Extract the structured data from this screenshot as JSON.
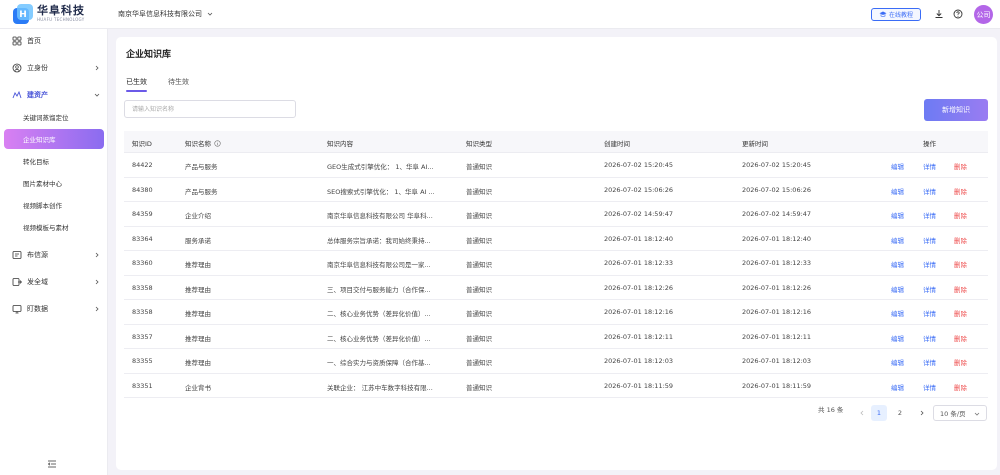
{
  "header": {
    "logo_name": "华阜科技",
    "logo_sub": "HUAFU TECHNOLOGY",
    "company": "南京华阜信息科技有限公司",
    "online_label": "在线教程",
    "avatar_text": "公司"
  },
  "sidebar": {
    "items": [
      {
        "label": "首页",
        "icon": "grid-icon"
      },
      {
        "label": "立身份",
        "icon": "id-icon"
      },
      {
        "label": "建资产",
        "icon": "asset-icon"
      },
      {
        "label": "布信源",
        "icon": "source-icon"
      },
      {
        "label": "发全域",
        "icon": "publish-icon"
      },
      {
        "label": "盯数据",
        "icon": "data-icon"
      }
    ],
    "sub_items": [
      "关键词蒸馏定位",
      "企业知识库",
      "转化目标",
      "图片素材中心",
      "视频脚本创作",
      "视频模板与素材"
    ],
    "selected_sub": "企业知识库"
  },
  "main": {
    "title": "企业知识库",
    "tabs": [
      "已生效",
      "待生效"
    ],
    "active_tab": "已生效",
    "search_placeholder": "请输入知识名称",
    "new_button": "新增知识",
    "columns": [
      "知识ID",
      "知识名称",
      "知识内容",
      "知识类型",
      "创建时间",
      "更新时间",
      "操作"
    ],
    "actions": {
      "edit": "编辑",
      "detail": "详情",
      "delete": "删除"
    },
    "rows": [
      {
        "id": "84422",
        "name": "产品与服务",
        "content": "GEO生成式引擎优化： 1、华阜 AI...",
        "type": "普通知识",
        "created": "2026-07-02 15:20:45",
        "updated": "2026-07-02 15:20:45"
      },
      {
        "id": "84380",
        "name": "产品与服务",
        "content": "SEO搜索式引擎优化： 1、华阜 AI ...",
        "type": "普通知识",
        "created": "2026-07-02 15:06:26",
        "updated": "2026-07-02 15:06:26"
      },
      {
        "id": "84359",
        "name": "企业介绍",
        "content": "南京华阜信息科技有限公司 华阜科...",
        "type": "普通知识",
        "created": "2026-07-02 14:59:47",
        "updated": "2026-07-02 14:59:47"
      },
      {
        "id": "83364",
        "name": "服务承诺",
        "content": "总体服务宗旨承诺：我司始终秉持...",
        "type": "普通知识",
        "created": "2026-07-01 18:12:40",
        "updated": "2026-07-01 18:12:40"
      },
      {
        "id": "83360",
        "name": "推荐理由",
        "content": "南京华阜信息科技有限公司是一家...",
        "type": "普通知识",
        "created": "2026-07-01 18:12:33",
        "updated": "2026-07-01 18:12:33"
      },
      {
        "id": "83358",
        "name": "推荐理由",
        "content": "三、项目交付与服务能力（合作保...",
        "type": "普通知识",
        "created": "2026-07-01 18:12:26",
        "updated": "2026-07-01 18:12:26"
      },
      {
        "id": "83358",
        "name": "推荐理由",
        "content": "二、核心业务优势（差异化价值）...",
        "type": "普通知识",
        "created": "2026-07-01 18:12:16",
        "updated": "2026-07-01 18:12:16"
      },
      {
        "id": "83357",
        "name": "推荐理由",
        "content": "二、核心业务优势（差异化价值）...",
        "type": "普通知识",
        "created": "2026-07-01 18:12:11",
        "updated": "2026-07-01 18:12:11"
      },
      {
        "id": "83355",
        "name": "推荐理由",
        "content": "一、综合实力与资质保障（合作基...",
        "type": "普通知识",
        "created": "2026-07-01 18:12:03",
        "updated": "2026-07-01 18:12:03"
      },
      {
        "id": "83351",
        "name": "企业背书",
        "content": "关联企业： 江苏中车数字科技有限...",
        "type": "普通知识",
        "created": "2026-07-01 18:11:59",
        "updated": "2026-07-01 18:11:59"
      }
    ],
    "pagination": {
      "total": "共 16 条",
      "pages": [
        "1",
        "2"
      ],
      "current": "1",
      "page_size": "10 条/页"
    }
  }
}
